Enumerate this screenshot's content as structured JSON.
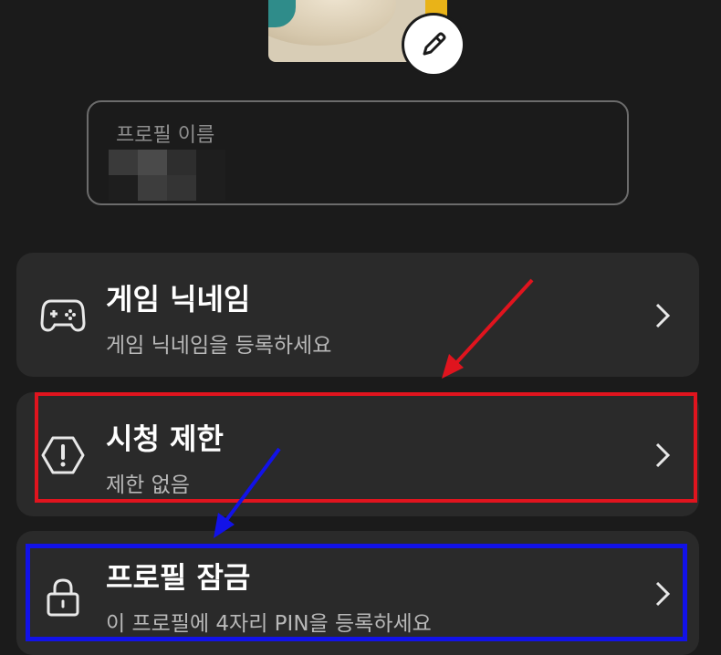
{
  "profile": {
    "name_label": "프로필 이름",
    "name_value_pixels": [
      "#3a3a3a",
      "#4a4a4a",
      "#2e2e2e",
      "#1e1e1e",
      "#1e1e1e",
      "#3d3d3d",
      "#343434",
      "#1e1e1e"
    ]
  },
  "menu": [
    {
      "title": "게임 닉네임",
      "subtitle": "게임 닉네임을 등록하세요",
      "icon": "gamepad-icon"
    },
    {
      "title": "시청 제한",
      "subtitle": "제한 없음",
      "icon": "warning-hexagon-icon"
    },
    {
      "title": "프로필 잠금",
      "subtitle": "이 프로필에 4자리 PIN을 등록하세요",
      "icon": "lock-icon"
    }
  ],
  "annotations": {
    "red_color": "#e0141e",
    "blue_color": "#1212e8"
  }
}
